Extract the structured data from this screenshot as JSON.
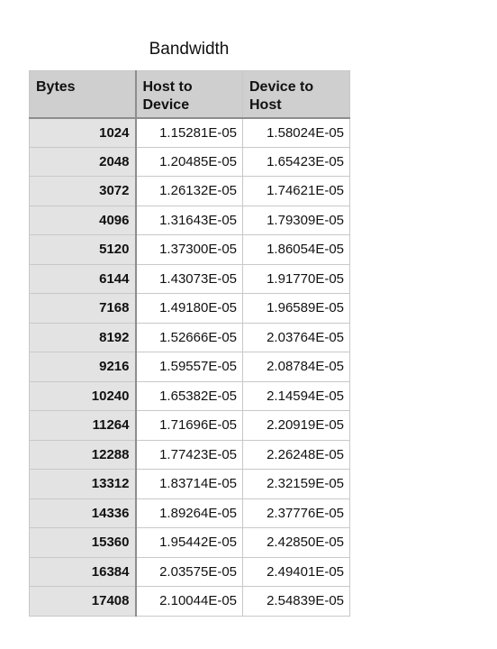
{
  "title": "Bandwidth",
  "columns": [
    "Bytes",
    "Host to\nDevice",
    "Device to\nHost"
  ],
  "rows": [
    [
      "1024",
      "1.15281E-05",
      "1.58024E-05"
    ],
    [
      "2048",
      "1.20485E-05",
      "1.65423E-05"
    ],
    [
      "3072",
      "1.26132E-05",
      "1.74621E-05"
    ],
    [
      "4096",
      "1.31643E-05",
      "1.79309E-05"
    ],
    [
      "5120",
      "1.37300E-05",
      "1.86054E-05"
    ],
    [
      "6144",
      "1.43073E-05",
      "1.91770E-05"
    ],
    [
      "7168",
      "1.49180E-05",
      "1.96589E-05"
    ],
    [
      "8192",
      "1.52666E-05",
      "2.03764E-05"
    ],
    [
      "9216",
      "1.59557E-05",
      "2.08784E-05"
    ],
    [
      "10240",
      "1.65382E-05",
      "2.14594E-05"
    ],
    [
      "11264",
      "1.71696E-05",
      "2.20919E-05"
    ],
    [
      "12288",
      "1.77423E-05",
      "2.26248E-05"
    ],
    [
      "13312",
      "1.83714E-05",
      "2.32159E-05"
    ],
    [
      "14336",
      "1.89264E-05",
      "2.37776E-05"
    ],
    [
      "15360",
      "1.95442E-05",
      "2.42850E-05"
    ],
    [
      "16384",
      "2.03575E-05",
      "2.49401E-05"
    ],
    [
      "17408",
      "2.10044E-05",
      "2.54839E-05"
    ]
  ]
}
